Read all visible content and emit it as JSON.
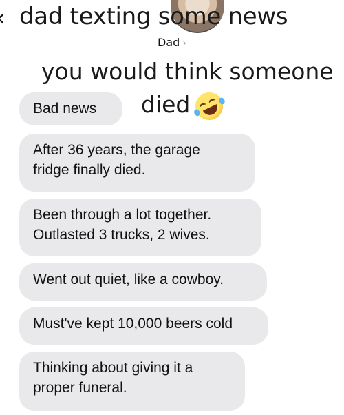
{
  "overlay": {
    "top_caption": "dad texting some news",
    "middle_caption_line1": "you would think someone",
    "middle_caption_line2": "died"
  },
  "header": {
    "contact_name": "Dad",
    "contact_chevron": "›",
    "back_chevron": "‹"
  },
  "messages": [
    {
      "text": "Bad news"
    },
    {
      "line1": "After 36 years, the garage",
      "line2": "fridge finally died."
    },
    {
      "line1": "Been through a lot together.",
      "line2": "Outlasted 3 trucks, 2 wives."
    },
    {
      "text": "Went out quiet, like a cowboy."
    },
    {
      "text": "Must've kept 10,000 beers cold"
    },
    {
      "line1": "Thinking about giving it a",
      "line2": "proper funeral."
    }
  ],
  "icons": {
    "avatar": "contact-avatar",
    "emoji": "rolling-on-floor-laughing-emoji"
  },
  "colors": {
    "bubble_bg": "#e9e9eb",
    "text": "#111111"
  }
}
